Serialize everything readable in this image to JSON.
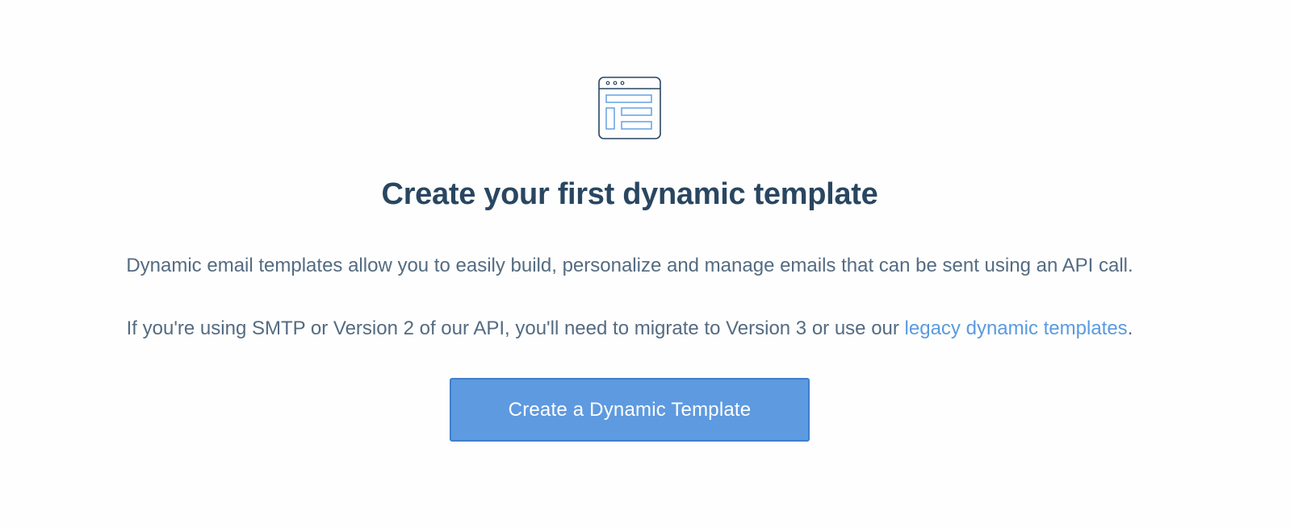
{
  "empty_state": {
    "icon": "browser-template-layout-icon",
    "title": "Create your first dynamic template",
    "description": "Dynamic email templates allow you to easily build, personalize and manage emails that can be sent using an API call.",
    "note_prefix": "If you're using SMTP or Version 2 of our API, you'll need to migrate to Version 3 or use our ",
    "note_link": "legacy dynamic templates",
    "note_suffix": ".",
    "button_label": "Create a Dynamic Template"
  },
  "colors": {
    "heading": "#294661",
    "body_text": "#546b81",
    "link": "#5a9ae0",
    "button_bg": "#5e9ae0",
    "button_border": "#3f7fcb",
    "icon_stroke": "#294661",
    "icon_accent": "#5a9ae0"
  }
}
